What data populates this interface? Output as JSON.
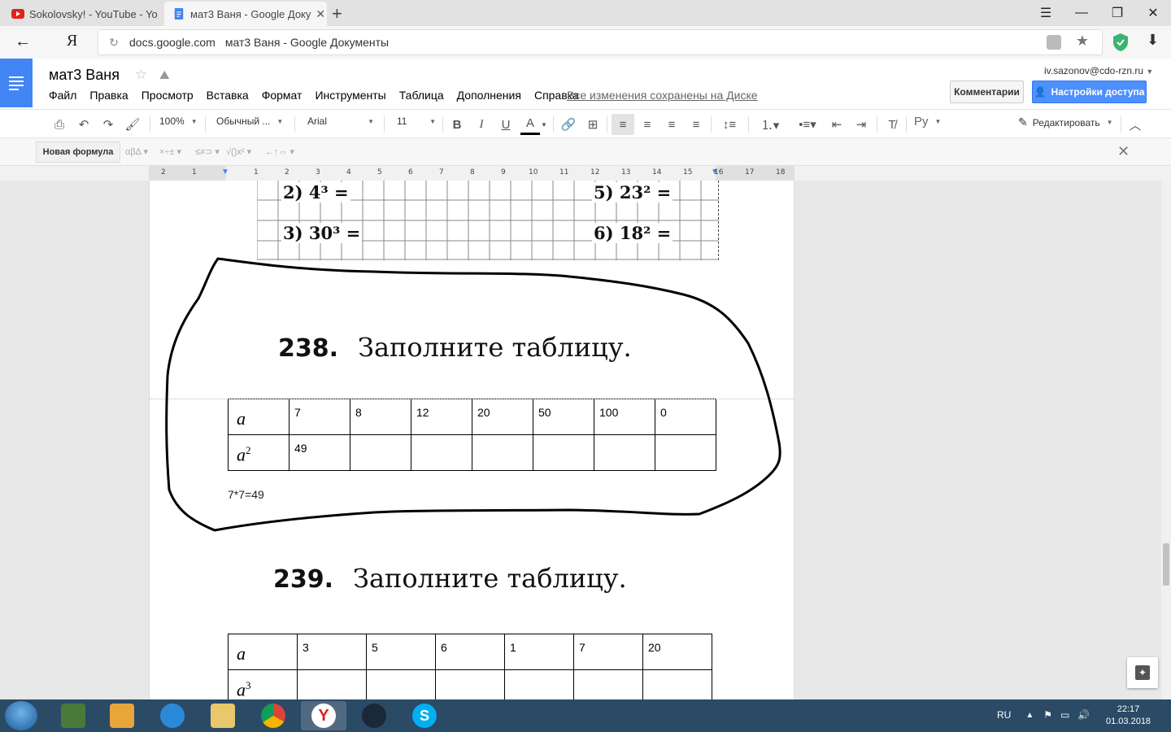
{
  "browser": {
    "tabs": [
      {
        "title": "Sokolovsky! - YouTube - Yo",
        "active": false
      },
      {
        "title": "мат3 Ваня - Google Доку",
        "active": true
      }
    ],
    "new_tab_glyph": "+",
    "url_domain": "docs.google.com",
    "url_page_title": "мат3 Ваня - Google Документы",
    "yandex_glyph": "Я"
  },
  "docs": {
    "title": "мат3 Ваня",
    "menu": [
      "Файл",
      "Правка",
      "Просмотр",
      "Вставка",
      "Формат",
      "Инструменты",
      "Таблица",
      "Дополнения",
      "Справка"
    ],
    "save_status": "Все изменения сохранены на Диске",
    "user_email": "iv.sazonov@cdo-rzn.ru",
    "comments_label": "Комментарии",
    "share_label": "Настройки доступа"
  },
  "toolbar": {
    "zoom": "100%",
    "style": "Обычный ...",
    "font": "Arial",
    "size": "11",
    "language": "Ру",
    "mode": "Редактировать"
  },
  "equation_bar": {
    "new_equation": "Новая формула",
    "groups": [
      "αβΔ",
      "×÷±",
      "≤≠⊃",
      "√()x²",
      "←↑⇔"
    ]
  },
  "ruler": {
    "ticks": [
      "2",
      "1",
      "1",
      "1",
      "2",
      "3",
      "4",
      "5",
      "6",
      "7",
      "8",
      "9",
      "10",
      "11",
      "12",
      "13",
      "14",
      "15",
      "16",
      "17",
      "18"
    ]
  },
  "content": {
    "scan_items": [
      "2) 4³ =",
      "3) 30³ =",
      "5) 23² =",
      "6) 18² ="
    ],
    "ex238": {
      "number": "238.",
      "title": "Заполните таблицу.",
      "row_a_label": "a",
      "row_b_label": "a",
      "row_b_exp": "2",
      "row_a": [
        "7",
        "8",
        "12",
        "20",
        "50",
        "100",
        "0"
      ],
      "row_b": [
        "49",
        "",
        "",
        "",
        "",
        "",
        ""
      ]
    },
    "note": "7*7=49",
    "ex239": {
      "number": "239.",
      "title": "Заполните таблицу.",
      "row_a_label": "a",
      "row_b_label": "a",
      "row_b_exp": "3",
      "row_a": [
        "3",
        "5",
        "6",
        "1",
        "7",
        "20"
      ],
      "row_b": [
        "",
        "",
        "",
        "",
        "",
        ""
      ]
    }
  },
  "taskbar": {
    "language": "RU",
    "time": "22:17",
    "date": "01.03.2018"
  },
  "colors": {
    "docs_blue": "#4285f4",
    "share_blue": "#4d90fe",
    "taskbar": "#2b4a66"
  }
}
